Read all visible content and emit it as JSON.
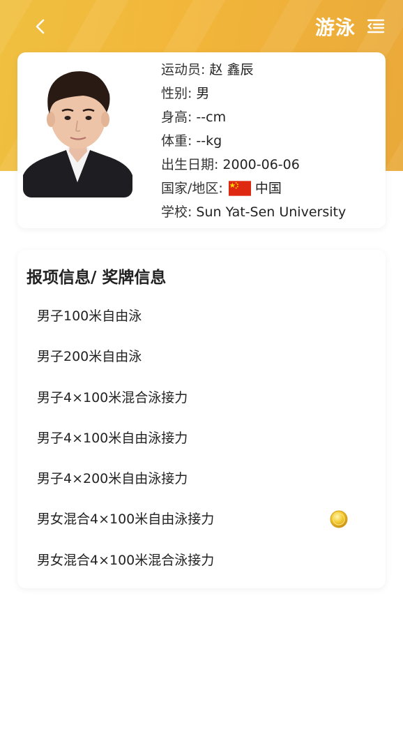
{
  "header": {
    "title": "游泳",
    "brand_color": "#f2b63a"
  },
  "profile": {
    "rows": [
      {
        "label": "运动员:",
        "value": "赵 鑫辰"
      },
      {
        "label": "性别:",
        "value": "男"
      },
      {
        "label": "身高:",
        "value": "--cm"
      },
      {
        "label": "体重:",
        "value": "--kg"
      },
      {
        "label": "出生日期:",
        "value": "2000-06-06"
      },
      {
        "label": "国家/地区:",
        "value": "中国",
        "flag": "china-flag-icon"
      },
      {
        "label": "学校:",
        "value": "Sun Yat-Sen University"
      }
    ]
  },
  "events": {
    "title": "报项信息/ 奖牌信息",
    "items": [
      {
        "name": "男子100米自由泳",
        "medal": null
      },
      {
        "name": "男子200米自由泳",
        "medal": null
      },
      {
        "name": "男子4×100米混合泳接力",
        "medal": null
      },
      {
        "name": "男子4×100米自由泳接力",
        "medal": null
      },
      {
        "name": "男子4×200米自由泳接力",
        "medal": null
      },
      {
        "name": "男女混合4×100米自由泳接力",
        "medal": "gold-medal-icon"
      },
      {
        "name": "男女混合4×100米混合泳接力",
        "medal": null
      }
    ]
  }
}
